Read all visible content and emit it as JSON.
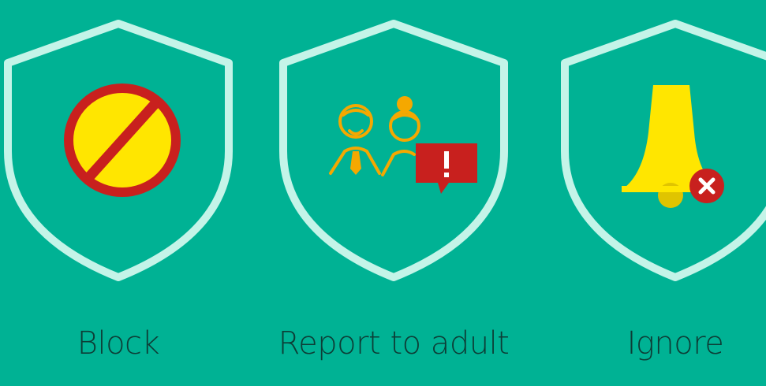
{
  "options": [
    {
      "label": "Block",
      "icon": "no-entry-icon"
    },
    {
      "label": "Report to adult",
      "icon": "adults-report-icon"
    },
    {
      "label": "Ignore",
      "icon": "bell-muted-icon"
    }
  ],
  "colors": {
    "background": "#00B294",
    "shield_outline": "#C4F4E8",
    "label_text": "#0d3d36",
    "icon_yellow": "#FFE600",
    "icon_red": "#C8201E",
    "adult_orange": "#F5A800"
  }
}
